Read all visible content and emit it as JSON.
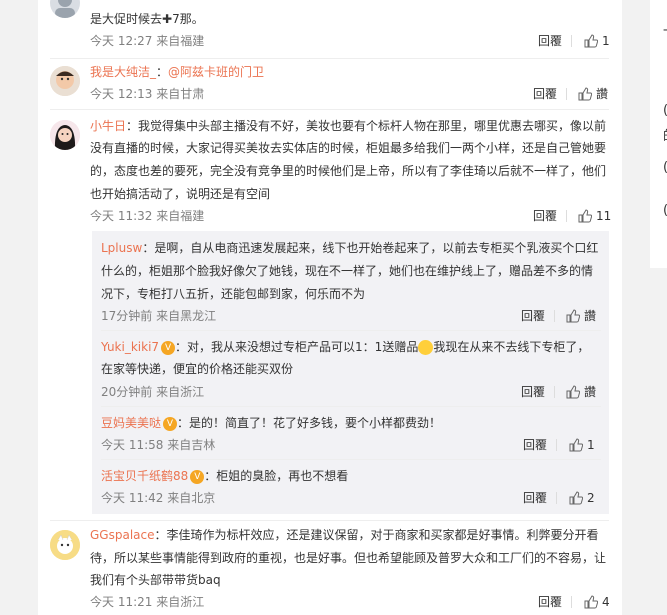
{
  "actions": {
    "reply": "回覆",
    "like_empty": "讚"
  },
  "c0": {
    "text_tail": "是大促时候去",
    "text_plus": "✚",
    "text_end": "7那。",
    "time": "今天 12:27 来自福建",
    "likes": "1"
  },
  "c1": {
    "user": "我是大纯洁_",
    "sep": "：",
    "mention": "@阿兹卡班的门卫",
    "time": "今天 12:13 来自甘肃"
  },
  "c2": {
    "user": "小牛日",
    "lines": [
      "：我觉得集中头部主播没有不好，美妆也要有个标杆人物在那里，哪里优惠去哪买，像以前",
      "没有直播的时候，大家记得买美妆去实体店的时候，柜姐最多给我们一两个小样，还是自己管她要",
      "的，态度也差的要死，完全没有竞争里的时候他们是上帝，所以有了李佳琦以后就不一样了，他们",
      "也开始搞活动了，说明还是有空间"
    ],
    "time": "今天 11:32 来自福建",
    "likes": "11"
  },
  "r1": {
    "user": "Lplusw",
    "lines": [
      "：是啊，自从电商迅速发展起来，线下也开始卷起来了，以前去专柜买个乳液买个口红",
      "什么的，柜姐那个脸我好像欠了她钱，现在不一样了，她们也在维护线上了，赠品差不多的情",
      "况下，专柜打八五折，还能包邮到家，何乐而不为"
    ],
    "time": "17分钟前 来自黑龙江"
  },
  "r2": {
    "user": "Yuki_kiki7",
    "badge": "V",
    "line1a": "：对，我从来没想过专柜产品可以1：1送赠品",
    "line1b": "我现在从来不去线下专柜了，",
    "line2": "在家等快递，便宜的价格还能买双份",
    "time": "20分钟前 来自浙江"
  },
  "r3": {
    "user": "豆妈美美哒",
    "badge": "V",
    "text": "：是的！简直了！花了好多钱，要个小样都费劲！",
    "time": "今天 11:58 来自吉林",
    "likes": "1"
  },
  "r4": {
    "user": "活宝贝千纸鹤88",
    "badge": "V",
    "text": "：柜姐的臭脸，再也不想看",
    "time": "今天 11:42 来自北京",
    "likes": "2"
  },
  "c3": {
    "user": "GGspalace",
    "lines": [
      "：李佳琦作为标杆效应，还是建议保留，对于商家和买家都是好事情。利弊要分开看",
      "待，所以某些事情能得到政府的重视，也是好事。但也希望能顾及普罗大众和工厂们的不容易，让",
      "我们有个头部带带货baq"
    ],
    "time": "今天 11:21 来自浙江",
    "likes": "4"
  },
  "right_card": {
    "glyphs": [
      "一",
      "(",
      "的",
      "(",
      "("
    ]
  },
  "colors": {
    "accent": "#eb7350",
    "muted": "#808080",
    "reply_bg": "#f2f2f5"
  }
}
